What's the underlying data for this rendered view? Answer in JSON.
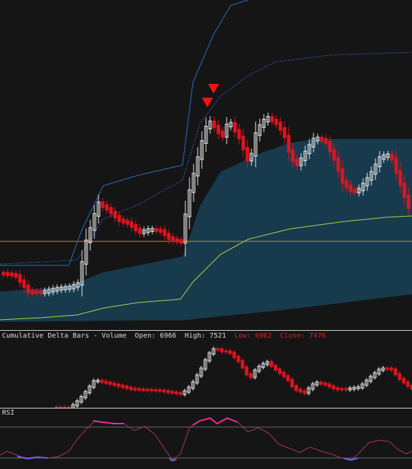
{
  "colors": {
    "background": "#151515",
    "bull_candle": "#f0f0f0",
    "bear_candle": "#e0141e",
    "band_fill": "#173a4d",
    "upper_envelope": "#2d6fd0",
    "mid_line": "#b9d84a",
    "horizontal_level": "#e08a1e",
    "signal_marker": "#ff1010",
    "rsi_line": "#b03a55",
    "rsi_overbought": "#ff2aa0",
    "rsi_oversold": "#6a5cff",
    "rsi_level_line": "#6a6a6a"
  },
  "main_chart": {
    "markers": [
      "down-triangle",
      "down-triangle"
    ]
  },
  "cdb_panel": {
    "title": "Cumulative Delta Bars - Volume",
    "open_label": "Open:",
    "open_value": "6966",
    "high_label": "High:",
    "high_value": "7521",
    "low_label": "Low:",
    "low_value": "6962",
    "close_label": "Close:",
    "close_value": "7476"
  },
  "rsi_panel": {
    "title": "RSI"
  }
}
